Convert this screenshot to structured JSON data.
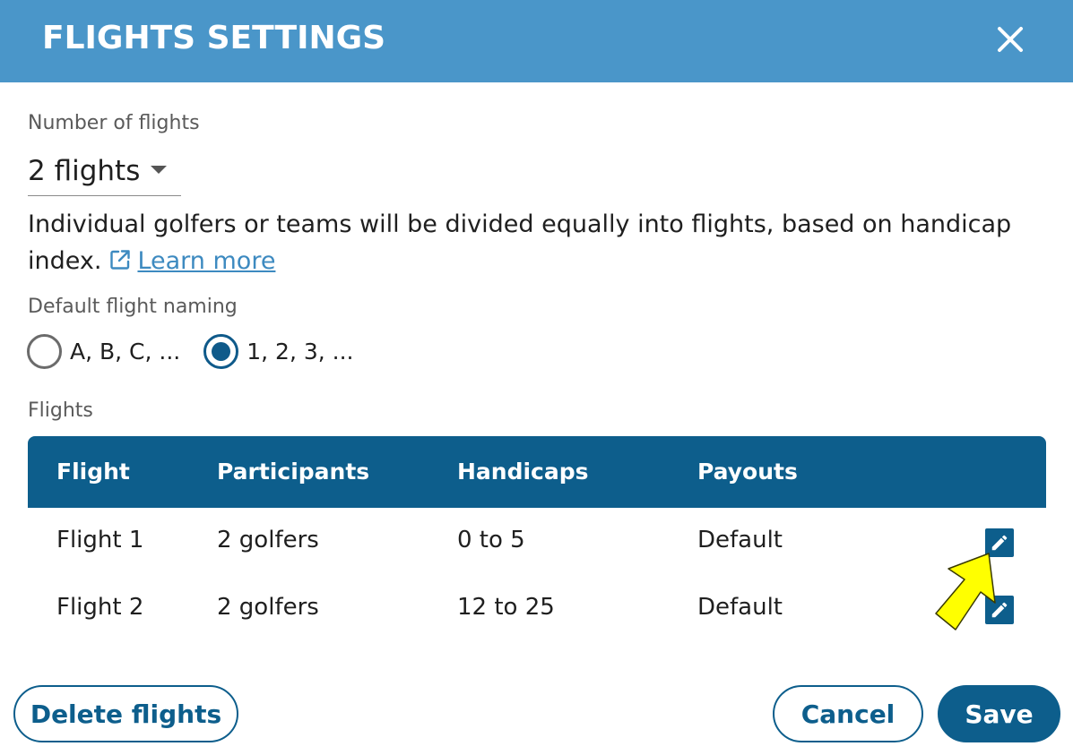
{
  "header": {
    "title": "FLIGHTS SETTINGS",
    "close_icon": "close-icon"
  },
  "number_of_flights": {
    "label": "Number of flights",
    "value": "2 flights"
  },
  "description": {
    "text": "Individual golfers or teams will be divided equally into flights, based on handicap index.",
    "link_label": "Learn more",
    "link_icon": "external-link-icon"
  },
  "naming": {
    "label": "Default flight naming",
    "options": [
      {
        "label": "A, B, C, ...",
        "selected": false
      },
      {
        "label": "1, 2, 3, ...",
        "selected": true
      }
    ]
  },
  "flights_table": {
    "label": "Flights",
    "columns": [
      "Flight",
      "Participants",
      "Handicaps",
      "Payouts"
    ],
    "rows": [
      {
        "flight": "Flight 1",
        "participants": "2 golfers",
        "handicaps": "0 to 5",
        "payouts": "Default"
      },
      {
        "flight": "Flight 2",
        "participants": "2 golfers",
        "handicaps": "12 to 25",
        "payouts": "Default"
      }
    ],
    "edit_icon": "pencil-icon"
  },
  "footer": {
    "delete_label": "Delete flights",
    "cancel_label": "Cancel",
    "save_label": "Save"
  },
  "colors": {
    "header_bg": "#4a96c9",
    "primary": "#0d5e8c",
    "link": "#3d8ac0",
    "highlight_arrow": "#ffff00"
  }
}
